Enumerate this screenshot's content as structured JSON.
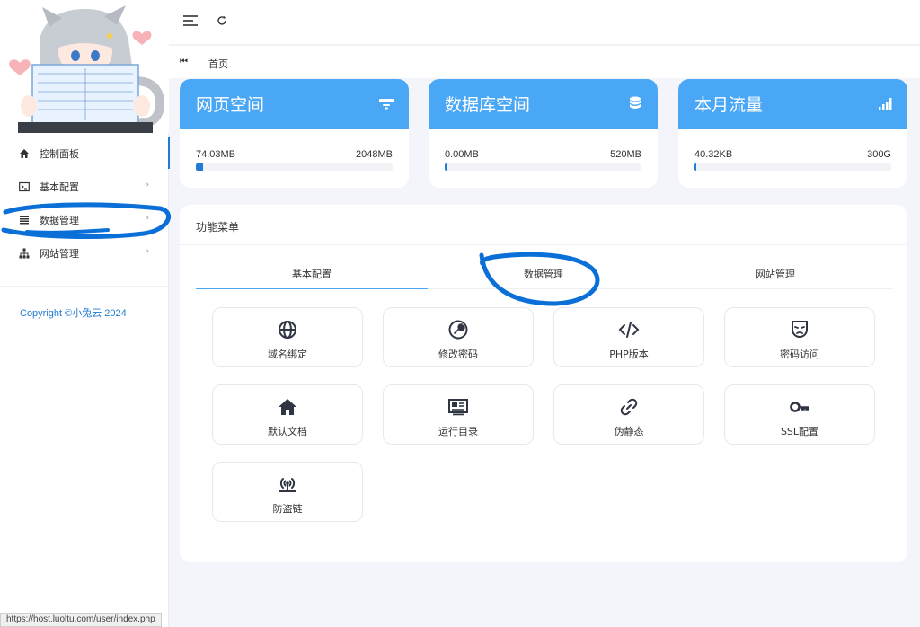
{
  "sidebar": {
    "items": [
      {
        "label": "控制面板",
        "icon": "home-icon"
      },
      {
        "label": "基本配置",
        "icon": "terminal-icon"
      },
      {
        "label": "数据管理",
        "icon": "list-icon"
      },
      {
        "label": "网站管理",
        "icon": "sitemap-icon"
      }
    ],
    "copyright": "Copyright ©小兔云 2024"
  },
  "tabbar": {
    "home": "首页"
  },
  "stats": [
    {
      "title": "网页空间",
      "left": "74.03MB",
      "right": "2048MB",
      "progress": 0.036,
      "icon": "hdd-icon"
    },
    {
      "title": "数据库空间",
      "left": "0.00MB",
      "right": "520MB",
      "progress": 0.0,
      "icon": "database-icon"
    },
    {
      "title": "本月流量",
      "left": "40.32KB",
      "right": "300G",
      "progress": 0.0001,
      "icon": "signal-icon"
    }
  ],
  "panel": {
    "title": "功能菜单",
    "tabs": [
      "基本配置",
      "数据管理",
      "网站管理"
    ],
    "tiles": [
      {
        "label": "域名绑定",
        "icon": "globe-icon"
      },
      {
        "label": "修改密码",
        "icon": "wrench-icon"
      },
      {
        "label": "PHP版本",
        "icon": "code-icon"
      },
      {
        "label": "密码访问",
        "icon": "mask-icon"
      },
      {
        "label": "默认文档",
        "icon": "house-icon"
      },
      {
        "label": "运行目录",
        "icon": "newspaper-icon"
      },
      {
        "label": "伪静态",
        "icon": "link-icon"
      },
      {
        "label": "SSL配置",
        "icon": "key-icon"
      },
      {
        "label": "防盗链",
        "icon": "broadcast-tower-icon"
      }
    ]
  },
  "status_bar": {
    "url": "https://host.luoltu.com/user/index.php"
  },
  "colors": {
    "accent": "#1f7bd6",
    "card_header": "#4aa7f5",
    "annotation": "#0b6fd8"
  }
}
